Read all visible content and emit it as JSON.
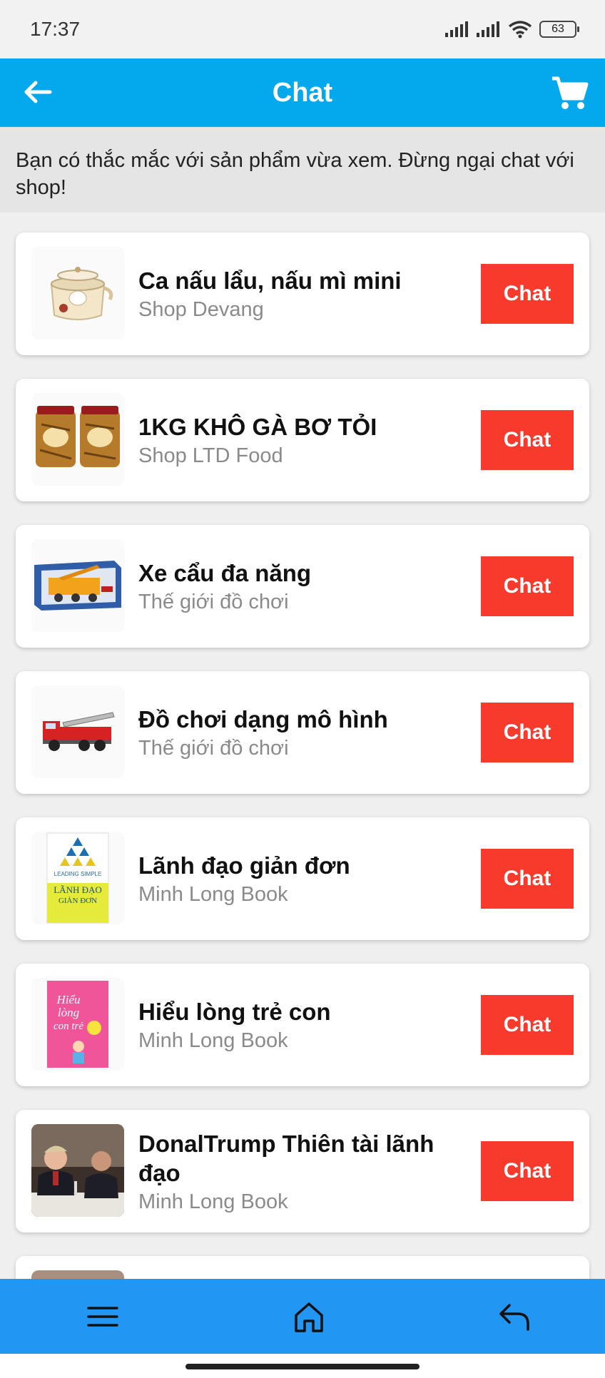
{
  "status_bar": {
    "time": "17:37",
    "battery": "63"
  },
  "header": {
    "title": "Chat"
  },
  "notice": {
    "text": "Bạn có thắc mắc với sản phẩm vừa xem. Đừng ngại chat với shop!"
  },
  "items": [
    {
      "name": "Ca nấu lẩu, nấu mì mini",
      "shop": "Shop Devang",
      "button": "Chat",
      "thumb": "electric-pot-image"
    },
    {
      "name": "1KG KHÔ GÀ BƠ TỎI",
      "shop": "Shop LTD Food",
      "button": "Chat",
      "thumb": "dried-chicken-jars-image"
    },
    {
      "name": "Xe cẩu đa năng",
      "shop": "Thế giới đồ chơi",
      "button": "Chat",
      "thumb": "toy-crane-box-image"
    },
    {
      "name": "Đồ chơi dạng mô hình",
      "shop": "Thế giới đồ chơi",
      "button": "Chat",
      "thumb": "toy-fire-truck-image"
    },
    {
      "name": "Lãnh đạo giản đơn",
      "shop": "Minh Long Book",
      "button": "Chat",
      "thumb": "leadership-book-cover",
      "cover_text": [
        "LEADING SIMPLE",
        "LÃNH ĐẠO",
        "GIẢN ĐƠN"
      ]
    },
    {
      "name": "Hiểu lòng trẻ con",
      "shop": "Minh Long Book",
      "button": "Chat",
      "thumb": "children-book-cover",
      "cover_text": [
        "Hiểu",
        "lòng",
        "con trẻ"
      ]
    },
    {
      "name": "DonalTrump Thiên tài lãnh đạo",
      "shop": "Minh Long Book",
      "button": "Chat",
      "thumb": "dinner-photo-image"
    }
  ],
  "bottom_nav": {
    "items": [
      "menu-icon",
      "home-icon",
      "return-icon"
    ]
  },
  "colors": {
    "header": "#03a9ec",
    "chat_button": "#f73a2c",
    "bottom_nav": "#2196f3"
  }
}
